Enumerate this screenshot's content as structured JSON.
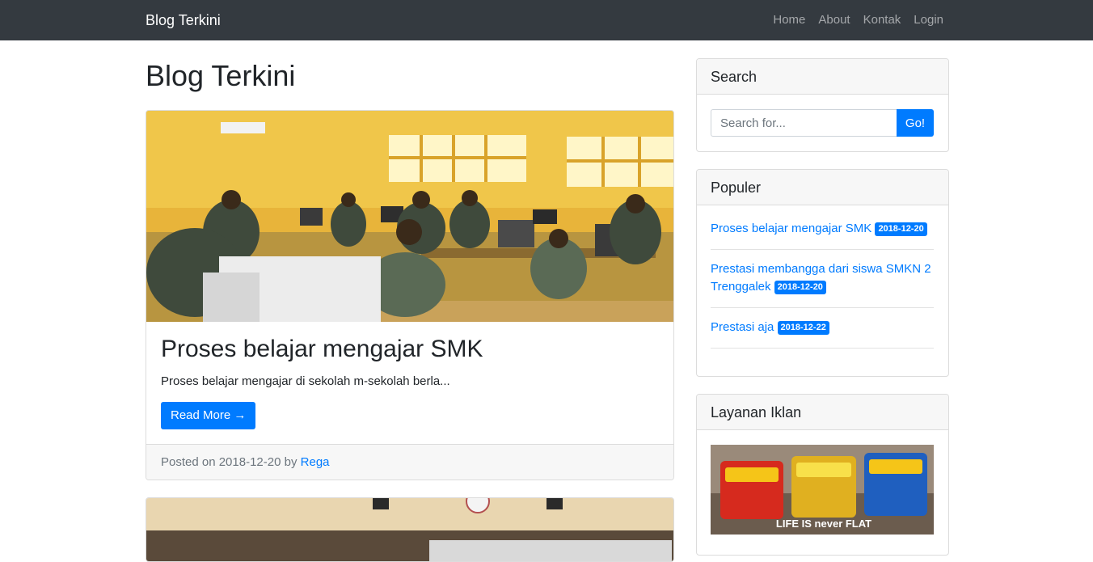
{
  "navbar": {
    "brand": "Blog Terkini",
    "links": [
      "Home",
      "About",
      "Kontak",
      "Login"
    ]
  },
  "main": {
    "heading": "Blog Terkini",
    "posts": [
      {
        "title": "Proses belajar mengajar SMK",
        "excerpt": "Proses belajar mengajar di sekolah m-sekolah berla...",
        "read_more": "Read More →",
        "posted_prefix": "Posted on 2018-12-20 by",
        "author": "Rega"
      }
    ]
  },
  "sidebar": {
    "search": {
      "title": "Search",
      "placeholder": "Search for...",
      "button": "Go!"
    },
    "populer": {
      "title": "Populer",
      "items": [
        {
          "title": "Proses belajar mengajar SMK",
          "date": "2018-12-20"
        },
        {
          "title": "Prestasi membangga dari siswa SMKN 2 Trenggalek",
          "date": "2018-12-20"
        },
        {
          "title": "Prestasi aja",
          "date": "2018-12-22"
        }
      ]
    },
    "iklan": {
      "title": "Layanan Iklan",
      "ad_text": "LIFE IS never FLAT"
    }
  },
  "colors": {
    "navbar_bg": "#343a40",
    "primary": "#007bff"
  }
}
